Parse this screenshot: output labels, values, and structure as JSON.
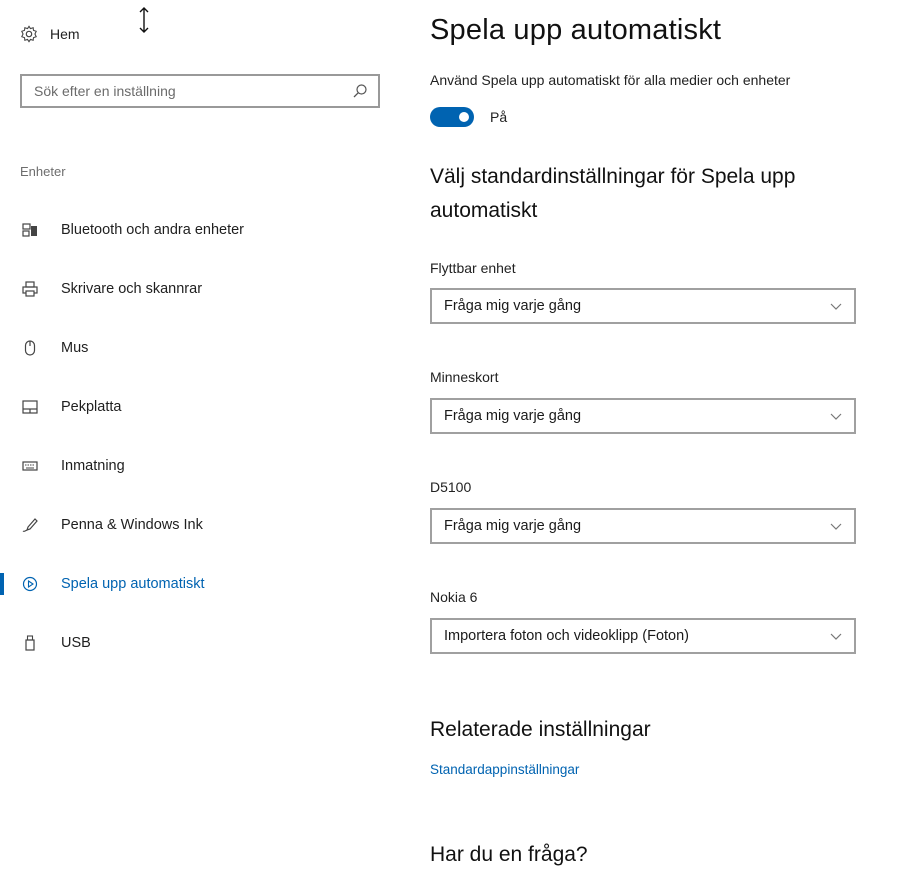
{
  "sidebar": {
    "home_label": "Hem",
    "search_placeholder": "Sök efter en inställning",
    "section_title": "Enheter",
    "items": [
      {
        "label": "Bluetooth och andra enheter",
        "icon": "bluetooth-devices-icon"
      },
      {
        "label": "Skrivare och skannrar",
        "icon": "printer-icon"
      },
      {
        "label": "Mus",
        "icon": "mouse-icon"
      },
      {
        "label": "Pekplatta",
        "icon": "touchpad-icon"
      },
      {
        "label": "Inmatning",
        "icon": "keyboard-icon"
      },
      {
        "label": "Penna & Windows Ink",
        "icon": "pen-icon"
      },
      {
        "label": "Spela upp automatiskt",
        "icon": "autoplay-icon",
        "active": true
      },
      {
        "label": "USB",
        "icon": "usb-icon"
      }
    ]
  },
  "main": {
    "title": "Spela upp automatiskt",
    "use_all_label": "Använd Spela upp automatiskt för alla medier och enheter",
    "toggle_state": "På",
    "toggle_on": true,
    "defaults_title": "Välj standardinställningar för Spela upp automatiskt",
    "fields": [
      {
        "label": "Flyttbar enhet",
        "value": "Fråga mig varje gång"
      },
      {
        "label": "Minneskort",
        "value": "Fråga mig varje gång"
      },
      {
        "label": "D5100",
        "value": "Fråga mig varje gång"
      },
      {
        "label": "Nokia 6",
        "value": "Importera foton och videoklipp (Foton)"
      }
    ],
    "related_title": "Relaterade inställningar",
    "related_link": "Standardappinställningar",
    "question_title": "Har du en fråga?"
  },
  "colors": {
    "accent": "#0063b1",
    "text": "#1f1f1f",
    "muted": "#6d6d6d",
    "border": "#a0a0a0"
  }
}
